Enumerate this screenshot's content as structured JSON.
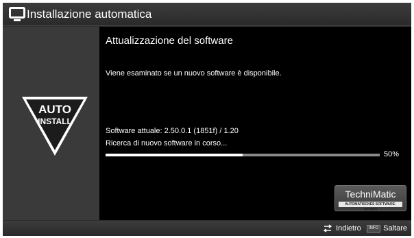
{
  "window": {
    "title": "Installazione automatica"
  },
  "sidebar": {
    "badge_line1": "AUTO",
    "badge_line2": "INSTALL",
    "badge_icon": "auto-install-triangle"
  },
  "main": {
    "heading": "Attualizzazione del software",
    "description": "Viene esaminato se un nuovo software è disponibile.",
    "current_software": "Software attuale: 2.50.0.1 (1851f) / 1.20",
    "status": "Ricerca di nuovo software in corso...",
    "progress": {
      "value": 0.5,
      "label": "50%"
    }
  },
  "logo": {
    "brand": "TechniMatic",
    "tagline": "AUTOMATISCHES SOFTWARE-UPDATE"
  },
  "footer": {
    "back_label": "Indietro",
    "info_key": "INFO",
    "skip_label": "Saltare"
  },
  "colors": {
    "background": "#2e2e2e",
    "content": "#000000",
    "accent": "#ffffff"
  }
}
